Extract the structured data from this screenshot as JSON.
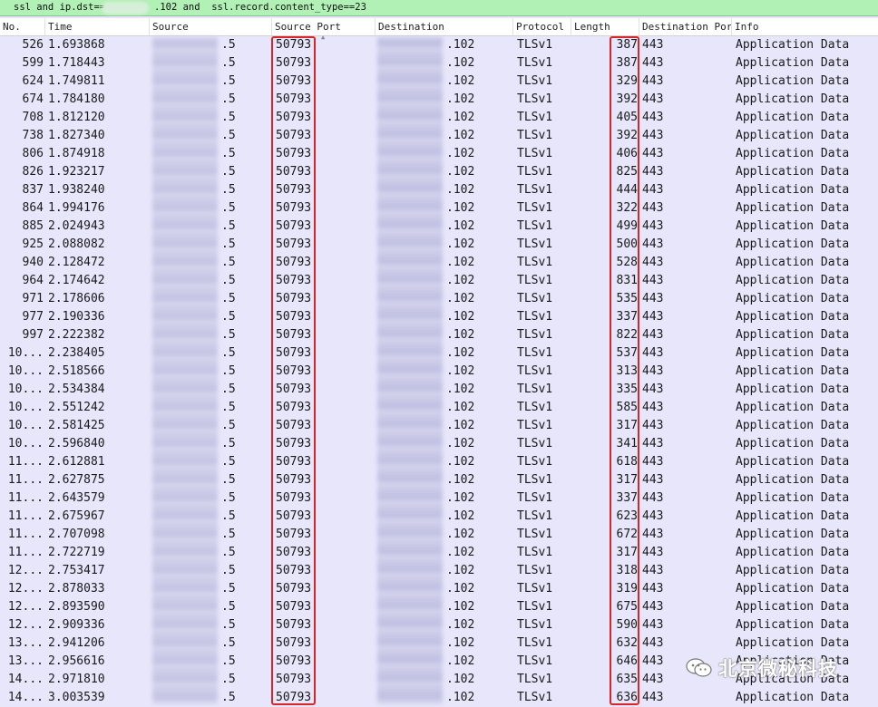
{
  "filter": {
    "text_before": "ssl and ip.dst==",
    "text_after": ".102 and  ssl.record.content_type==23"
  },
  "columns": [
    "No.",
    "Time",
    "Source",
    "Source Port",
    "Destination",
    "Protocol",
    "Length",
    "Destination Port",
    "Info"
  ],
  "packets": [
    {
      "no": "526",
      "time": "1.693868",
      "src": ".5",
      "sport": "50793",
      "dst": ".102",
      "proto": "TLSv1",
      "len": "387",
      "dport": "443",
      "info": "Application Data"
    },
    {
      "no": "599",
      "time": "1.718443",
      "src": ".5",
      "sport": "50793",
      "dst": ".102",
      "proto": "TLSv1",
      "len": "387",
      "dport": "443",
      "info": "Application Data"
    },
    {
      "no": "624",
      "time": "1.749811",
      "src": ".5",
      "sport": "50793",
      "dst": ".102",
      "proto": "TLSv1",
      "len": "329",
      "dport": "443",
      "info": "Application Data"
    },
    {
      "no": "674",
      "time": "1.784180",
      "src": ".5",
      "sport": "50793",
      "dst": ".102",
      "proto": "TLSv1",
      "len": "392",
      "dport": "443",
      "info": "Application Data"
    },
    {
      "no": "708",
      "time": "1.812120",
      "src": ".5",
      "sport": "50793",
      "dst": ".102",
      "proto": "TLSv1",
      "len": "405",
      "dport": "443",
      "info": "Application Data"
    },
    {
      "no": "738",
      "time": "1.827340",
      "src": ".5",
      "sport": "50793",
      "dst": ".102",
      "proto": "TLSv1",
      "len": "392",
      "dport": "443",
      "info": "Application Data"
    },
    {
      "no": "806",
      "time": "1.874918",
      "src": ".5",
      "sport": "50793",
      "dst": ".102",
      "proto": "TLSv1",
      "len": "406",
      "dport": "443",
      "info": "Application Data"
    },
    {
      "no": "826",
      "time": "1.923217",
      "src": ".5",
      "sport": "50793",
      "dst": ".102",
      "proto": "TLSv1",
      "len": "825",
      "dport": "443",
      "info": "Application Data"
    },
    {
      "no": "837",
      "time": "1.938240",
      "src": ".5",
      "sport": "50793",
      "dst": ".102",
      "proto": "TLSv1",
      "len": "444",
      "dport": "443",
      "info": "Application Data"
    },
    {
      "no": "864",
      "time": "1.994176",
      "src": ".5",
      "sport": "50793",
      "dst": ".102",
      "proto": "TLSv1",
      "len": "322",
      "dport": "443",
      "info": "Application Data"
    },
    {
      "no": "885",
      "time": "2.024943",
      "src": ".5",
      "sport": "50793",
      "dst": ".102",
      "proto": "TLSv1",
      "len": "499",
      "dport": "443",
      "info": "Application Data"
    },
    {
      "no": "925",
      "time": "2.088082",
      "src": ".5",
      "sport": "50793",
      "dst": ".102",
      "proto": "TLSv1",
      "len": "500",
      "dport": "443",
      "info": "Application Data"
    },
    {
      "no": "940",
      "time": "2.128472",
      "src": ".5",
      "sport": "50793",
      "dst": ".102",
      "proto": "TLSv1",
      "len": "528",
      "dport": "443",
      "info": "Application Data"
    },
    {
      "no": "964",
      "time": "2.174642",
      "src": ".5",
      "sport": "50793",
      "dst": ".102",
      "proto": "TLSv1",
      "len": "831",
      "dport": "443",
      "info": "Application Data"
    },
    {
      "no": "971",
      "time": "2.178606",
      "src": ".5",
      "sport": "50793",
      "dst": ".102",
      "proto": "TLSv1",
      "len": "535",
      "dport": "443",
      "info": "Application Data"
    },
    {
      "no": "977",
      "time": "2.190336",
      "src": ".5",
      "sport": "50793",
      "dst": ".102",
      "proto": "TLSv1",
      "len": "337",
      "dport": "443",
      "info": "Application Data"
    },
    {
      "no": "997",
      "time": "2.222382",
      "src": ".5",
      "sport": "50793",
      "dst": ".102",
      "proto": "TLSv1",
      "len": "822",
      "dport": "443",
      "info": "Application Data"
    },
    {
      "no": "10...",
      "time": "2.238405",
      "src": ".5",
      "sport": "50793",
      "dst": ".102",
      "proto": "TLSv1",
      "len": "537",
      "dport": "443",
      "info": "Application Data"
    },
    {
      "no": "10...",
      "time": "2.518566",
      "src": ".5",
      "sport": "50793",
      "dst": ".102",
      "proto": "TLSv1",
      "len": "313",
      "dport": "443",
      "info": "Application Data"
    },
    {
      "no": "10...",
      "time": "2.534384",
      "src": ".5",
      "sport": "50793",
      "dst": ".102",
      "proto": "TLSv1",
      "len": "335",
      "dport": "443",
      "info": "Application Data"
    },
    {
      "no": "10...",
      "time": "2.551242",
      "src": ".5",
      "sport": "50793",
      "dst": ".102",
      "proto": "TLSv1",
      "len": "585",
      "dport": "443",
      "info": "Application Data"
    },
    {
      "no": "10...",
      "time": "2.581425",
      "src": ".5",
      "sport": "50793",
      "dst": ".102",
      "proto": "TLSv1",
      "len": "317",
      "dport": "443",
      "info": "Application Data"
    },
    {
      "no": "10...",
      "time": "2.596840",
      "src": ".5",
      "sport": "50793",
      "dst": ".102",
      "proto": "TLSv1",
      "len": "341",
      "dport": "443",
      "info": "Application Data"
    },
    {
      "no": "11...",
      "time": "2.612881",
      "src": ".5",
      "sport": "50793",
      "dst": ".102",
      "proto": "TLSv1",
      "len": "618",
      "dport": "443",
      "info": "Application Data"
    },
    {
      "no": "11...",
      "time": "2.627875",
      "src": ".5",
      "sport": "50793",
      "dst": ".102",
      "proto": "TLSv1",
      "len": "317",
      "dport": "443",
      "info": "Application Data"
    },
    {
      "no": "11...",
      "time": "2.643579",
      "src": ".5",
      "sport": "50793",
      "dst": ".102",
      "proto": "TLSv1",
      "len": "337",
      "dport": "443",
      "info": "Application Data"
    },
    {
      "no": "11...",
      "time": "2.675967",
      "src": ".5",
      "sport": "50793",
      "dst": ".102",
      "proto": "TLSv1",
      "len": "623",
      "dport": "443",
      "info": "Application Data"
    },
    {
      "no": "11...",
      "time": "2.707098",
      "src": ".5",
      "sport": "50793",
      "dst": ".102",
      "proto": "TLSv1",
      "len": "672",
      "dport": "443",
      "info": "Application Data"
    },
    {
      "no": "11...",
      "time": "2.722719",
      "src": ".5",
      "sport": "50793",
      "dst": ".102",
      "proto": "TLSv1",
      "len": "317",
      "dport": "443",
      "info": "Application Data"
    },
    {
      "no": "12...",
      "time": "2.753417",
      "src": ".5",
      "sport": "50793",
      "dst": ".102",
      "proto": "TLSv1",
      "len": "318",
      "dport": "443",
      "info": "Application Data"
    },
    {
      "no": "12...",
      "time": "2.878033",
      "src": ".5",
      "sport": "50793",
      "dst": ".102",
      "proto": "TLSv1",
      "len": "319",
      "dport": "443",
      "info": "Application Data"
    },
    {
      "no": "12...",
      "time": "2.893590",
      "src": ".5",
      "sport": "50793",
      "dst": ".102",
      "proto": "TLSv1",
      "len": "675",
      "dport": "443",
      "info": "Application Data"
    },
    {
      "no": "12...",
      "time": "2.909336",
      "src": ".5",
      "sport": "50793",
      "dst": ".102",
      "proto": "TLSv1",
      "len": "590",
      "dport": "443",
      "info": "Application Data"
    },
    {
      "no": "13...",
      "time": "2.941206",
      "src": ".5",
      "sport": "50793",
      "dst": ".102",
      "proto": "TLSv1",
      "len": "632",
      "dport": "443",
      "info": "Application Data"
    },
    {
      "no": "13...",
      "time": "2.956616",
      "src": ".5",
      "sport": "50793",
      "dst": ".102",
      "proto": "TLSv1",
      "len": "646",
      "dport": "443",
      "info": "Application Data"
    },
    {
      "no": "14...",
      "time": "2.971810",
      "src": ".5",
      "sport": "50793",
      "dst": ".102",
      "proto": "TLSv1",
      "len": "635",
      "dport": "443",
      "info": "Application Data"
    },
    {
      "no": "14...",
      "time": "3.003539",
      "src": ".5",
      "sport": "50793",
      "dst": ".102",
      "proto": "TLSv1",
      "len": "636",
      "dport": "443",
      "info": "Application Data"
    }
  ],
  "watermark": {
    "icon": "wechat-icon",
    "text": "北京微秘科技"
  },
  "colors": {
    "filter_valid": "#b1f1b5",
    "row_tls": "#e7e6fb",
    "highlight": "#d8252a"
  }
}
